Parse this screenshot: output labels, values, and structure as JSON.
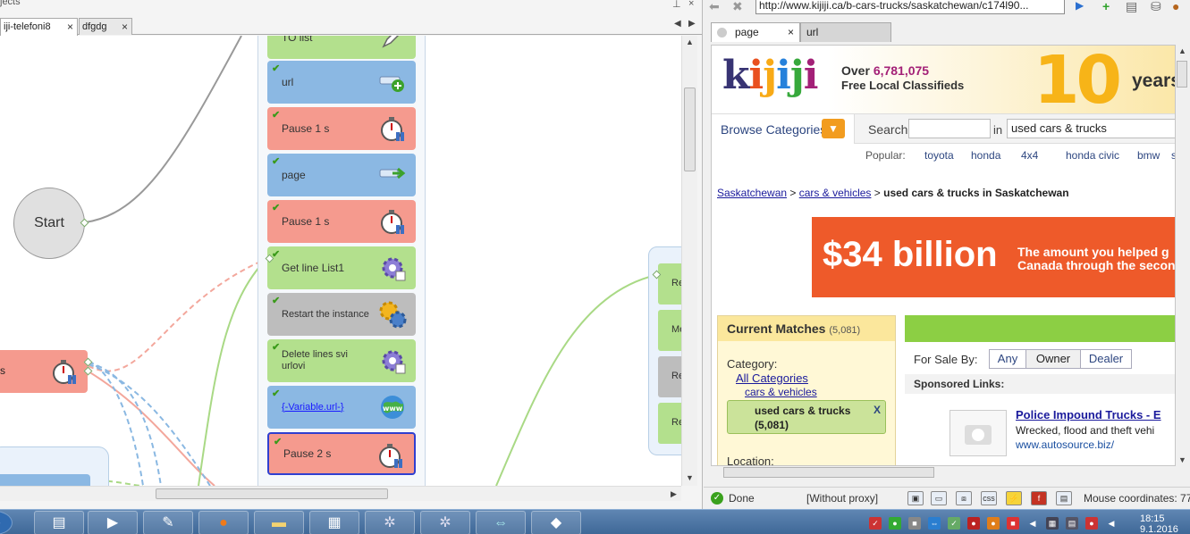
{
  "designer": {
    "panel_caption": "jects",
    "tabs": [
      {
        "label": "iji-telefoni8",
        "close": "×"
      },
      {
        "label": "dfgdg",
        "close": "×"
      }
    ],
    "start_label": "Start",
    "blocks": [
      {
        "label": "TO list",
        "color": "green",
        "icon": "pen-icon"
      },
      {
        "label": "url",
        "color": "blue",
        "icon": "add-link-icon"
      },
      {
        "label": "Pause 1 s",
        "color": "red",
        "icon": "stopwatch-icon"
      },
      {
        "label": "page",
        "color": "blue",
        "icon": "arrow-right-icon"
      },
      {
        "label": "Pause 1 s",
        "color": "red",
        "icon": "stopwatch-icon"
      },
      {
        "label": "Get line List1",
        "color": "green",
        "icon": "gear-icon"
      },
      {
        "label": "Restart the instance",
        "color": "gray",
        "icon": "gears-icon"
      },
      {
        "label": "Delete lines svi urlovi",
        "color": "green",
        "icon": "gear-icon"
      },
      {
        "label": "{-Variable.url-}",
        "color": "blue",
        "icon": "globe-icon"
      },
      {
        "label": "Pause 2 s",
        "color": "red",
        "icon": "stopwatch-icon"
      }
    ],
    "left_block_label": "s",
    "right_group_labels": [
      "Re",
      "Me",
      "Re",
      "Re"
    ]
  },
  "browser": {
    "url": "http://www.kijiji.ca/b-cars-trucks/saskatchewan/c174l90...",
    "tabs": [
      {
        "label": "page",
        "close": "×"
      },
      {
        "label": "url"
      }
    ],
    "site": {
      "logo": "kijiji",
      "over_prefix": "Over",
      "listing_count": "6,781,075",
      "tagline": "Free Local Classifieds",
      "ten": "10",
      "years": "years",
      "browse_label": "Browse Categories",
      "search_label": "Search",
      "in_label": "in",
      "query": "used cars & trucks",
      "popular_label": "Popular:",
      "popular_links": [
        "toyota",
        "honda",
        "4x4",
        "honda civic",
        "bmw",
        "s"
      ],
      "breadcrumb": {
        "province": "Saskatchewan",
        "sep1": " > ",
        "category": "cars & vehicles",
        "sep2": " > ",
        "current": "used cars & trucks in Saskatchewan"
      },
      "banner_amount": "$34 billion",
      "banner_line1": "The amount you helped g",
      "banner_line2": "Canada through the secon",
      "matches_title": "Current Matches",
      "matches_count": "(5,081)",
      "category_label": "Category:",
      "all_categories": "All Categories",
      "cars_vehicles": "cars & vehicles",
      "selected_category": "used cars & trucks",
      "selected_count": "(5,081)",
      "selected_remove": "X",
      "location_label": "Location:",
      "for_sale_by": "For Sale By:",
      "seller_options": [
        "Any",
        "Owner",
        "Dealer"
      ],
      "selected_seller": "Owner",
      "sponsored": "Sponsored Links:",
      "ad_title": "Police Impound Trucks - E",
      "ad_desc": "Wrecked, flood and theft vehi",
      "ad_url": "www.autosource.biz/"
    },
    "status": {
      "done": "Done",
      "proxy": "[Without proxy]",
      "mouse": "Mouse coordinates: 77"
    }
  },
  "taskbar": {
    "time": "18:15",
    "date": "9.1.2016"
  },
  "colors": {
    "green_block": "#b3e08d",
    "blue_block": "#8bb8e3",
    "red_block": "#f59a8e",
    "gray_block": "#bdbdbd",
    "kijiji_orange": "#ee5a2a",
    "kijiji_green": "#8ccf44"
  }
}
